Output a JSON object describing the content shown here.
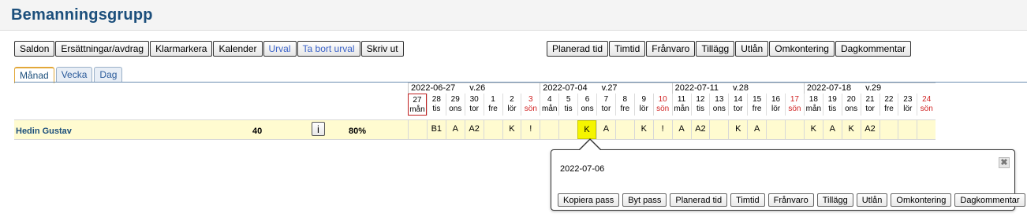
{
  "title": "Bemanningsgrupp",
  "toolbar_left": [
    {
      "label": "Saldon",
      "blue": false
    },
    {
      "label": "Ersättningar/avdrag",
      "blue": false
    },
    {
      "label": "Klarmarkera",
      "blue": false
    },
    {
      "label": "Kalender",
      "blue": false
    },
    {
      "label": "Urval",
      "blue": true
    },
    {
      "label": "Ta bort urval",
      "blue": true
    },
    {
      "label": "Skriv ut",
      "blue": false
    }
  ],
  "toolbar_right": [
    "Planerad tid",
    "Timtid",
    "Frånvaro",
    "Tillägg",
    "Utlån",
    "Omkontering",
    "Dagkommentar"
  ],
  "tabs": [
    {
      "label": "Månad",
      "active": true
    },
    {
      "label": "Vecka",
      "active": false
    },
    {
      "label": "Dag",
      "active": false
    }
  ],
  "weeks": [
    {
      "date": "2022-06-27",
      "week": "v.26"
    },
    {
      "date": "2022-07-04",
      "week": "v.27"
    },
    {
      "date": "2022-07-11",
      "week": "v.28"
    },
    {
      "date": "2022-07-18",
      "week": "v.29"
    }
  ],
  "days": [
    {
      "n": "27",
      "d": "mån",
      "sun": false,
      "today": true
    },
    {
      "n": "28",
      "d": "tis"
    },
    {
      "n": "29",
      "d": "ons"
    },
    {
      "n": "30",
      "d": "tor"
    },
    {
      "n": "1",
      "d": "fre"
    },
    {
      "n": "2",
      "d": "lör"
    },
    {
      "n": "3",
      "d": "sön",
      "sun": true
    },
    {
      "n": "4",
      "d": "mån"
    },
    {
      "n": "5",
      "d": "tis"
    },
    {
      "n": "6",
      "d": "ons"
    },
    {
      "n": "7",
      "d": "tor"
    },
    {
      "n": "8",
      "d": "fre"
    },
    {
      "n": "9",
      "d": "lör"
    },
    {
      "n": "10",
      "d": "sön",
      "sun": true
    },
    {
      "n": "11",
      "d": "mån"
    },
    {
      "n": "12",
      "d": "tis"
    },
    {
      "n": "13",
      "d": "ons"
    },
    {
      "n": "14",
      "d": "tor"
    },
    {
      "n": "15",
      "d": "fre"
    },
    {
      "n": "16",
      "d": "lör"
    },
    {
      "n": "17",
      "d": "sön",
      "sun": true
    },
    {
      "n": "18",
      "d": "mån"
    },
    {
      "n": "19",
      "d": "tis"
    },
    {
      "n": "20",
      "d": "ons"
    },
    {
      "n": "21",
      "d": "tor"
    },
    {
      "n": "22",
      "d": "fre"
    },
    {
      "n": "23",
      "d": "lör"
    },
    {
      "n": "24",
      "d": "sön",
      "sun": true
    }
  ],
  "employee": {
    "name": "Hedin Gustav",
    "hours": "40",
    "info": "i",
    "percent": "80%",
    "cells": [
      "",
      "B1",
      "A",
      "A2",
      "",
      "K",
      "!",
      "",
      "",
      "K",
      "A",
      "",
      "K",
      "!",
      "A",
      "A2",
      "",
      "K",
      "A",
      "",
      "",
      "K",
      "A",
      "K",
      "A2",
      "",
      "",
      ""
    ],
    "selected_index": 9
  },
  "popup": {
    "date": "2022-07-06",
    "close": "✖",
    "buttons": [
      "Kopiera pass",
      "Byt pass",
      "Planerad tid",
      "Timtid",
      "Frånvaro",
      "Tillägg",
      "Utlån",
      "Omkontering",
      "Dagkommentar"
    ]
  }
}
